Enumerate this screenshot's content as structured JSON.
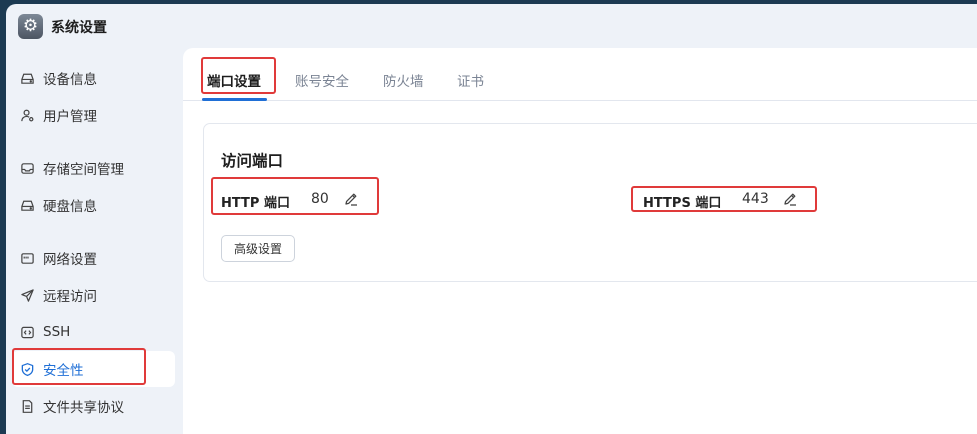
{
  "window": {
    "title": "系统设置"
  },
  "sidebar": {
    "items": [
      {
        "label": "设备信息",
        "icon": "device-icon"
      },
      {
        "label": "用户管理",
        "icon": "user-icon"
      },
      {
        "label": "存储空间管理",
        "icon": "storage-icon"
      },
      {
        "label": "硬盘信息",
        "icon": "disk-icon"
      },
      {
        "label": "网络设置",
        "icon": "network-icon"
      },
      {
        "label": "远程访问",
        "icon": "send-icon"
      },
      {
        "label": "SSH",
        "icon": "code-icon"
      },
      {
        "label": "安全性",
        "icon": "shield-icon",
        "active": true
      },
      {
        "label": "文件共享协议",
        "icon": "file-icon"
      }
    ]
  },
  "tabs": [
    {
      "label": "端口设置",
      "active": true
    },
    {
      "label": "账号安全"
    },
    {
      "label": "防火墙"
    },
    {
      "label": "证书"
    }
  ],
  "access_port": {
    "title": "访问端口",
    "http_label": "HTTP 端口",
    "http_value": "80",
    "https_label": "HTTPS 端口",
    "https_value": "443",
    "advanced_button": "高级设置"
  },
  "colors": {
    "accent": "#1f6fd6",
    "highlight": "#e03a3a",
    "sidebar_bg": "#eef2f8"
  }
}
